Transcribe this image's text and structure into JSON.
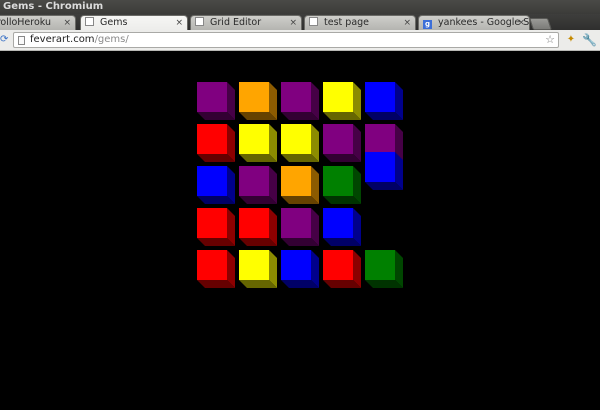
{
  "window": {
    "title": "Gems - Chromium"
  },
  "tabs": [
    {
      "title": "PolloHeroku",
      "favicon": "doc-icon"
    },
    {
      "title": "Gems",
      "favicon": "doc-icon",
      "active": true
    },
    {
      "title": "Grid Editor",
      "favicon": "doc-icon"
    },
    {
      "title": "test page",
      "favicon": "doc-icon"
    },
    {
      "title": "yankees - Google Se",
      "favicon": "google-icon"
    }
  ],
  "tab_close_glyph": "×",
  "toolbar": {
    "url_host": "feverart.com",
    "url_path": "/gems/",
    "icons": [
      "reload-icon",
      "page-icon",
      "bookmark-star-icon",
      "extension-icon",
      "wrench-menu-icon"
    ]
  },
  "colors": {
    "purple": "#800080",
    "orange": "#ffa500",
    "yellow": "#ffff00",
    "blue": "#0000ff",
    "red": "#ff0000",
    "green": "#008000"
  },
  "game": {
    "columns": [
      [
        "purple",
        "red",
        "blue",
        "red",
        "red"
      ],
      [
        "orange",
        "yellow",
        "purple",
        "red",
        "yellow"
      ],
      [
        "purple",
        "yellow",
        "orange",
        "purple",
        "blue"
      ],
      [
        "yellow",
        "purple",
        "green",
        "blue",
        "red"
      ],
      [
        "blue",
        "purple",
        "blue",
        null,
        "green"
      ]
    ]
  }
}
